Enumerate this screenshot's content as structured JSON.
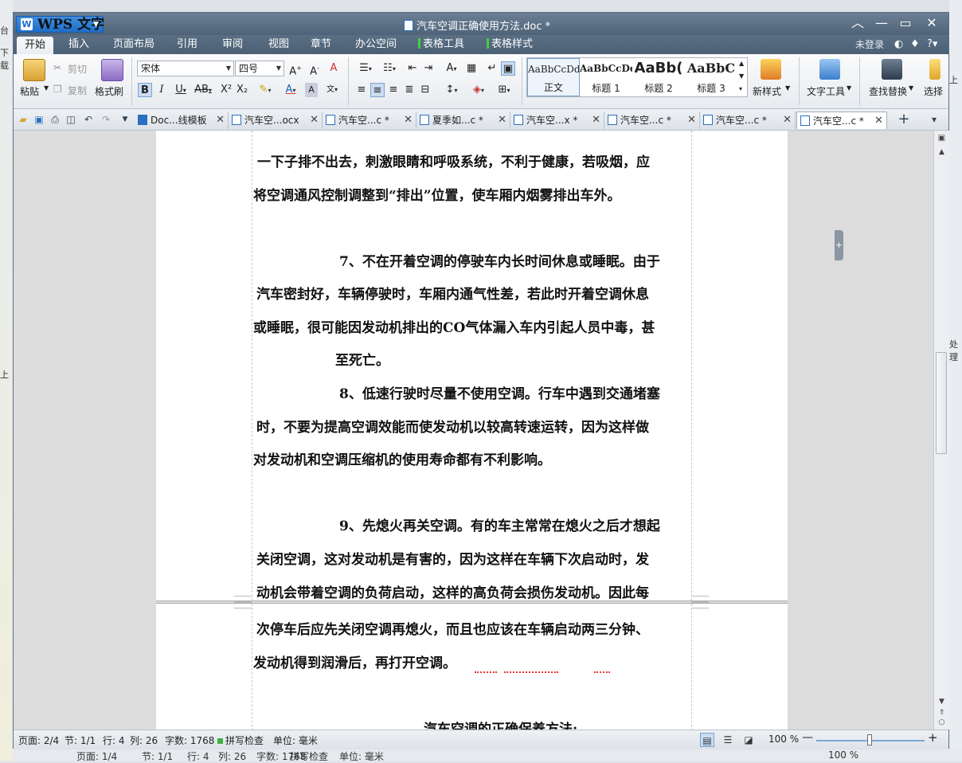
{
  "app": {
    "button_label": "WPS 文字",
    "doc_title": "汽车空调正确使用方法.doc *",
    "account_status": "未登录"
  },
  "menus": [
    "开始",
    "插入",
    "页面布局",
    "引用",
    "审阅",
    "视图",
    "章节",
    "办公空间",
    "表格工具",
    "表格样式"
  ],
  "ribbon": {
    "paste": "粘贴",
    "cut": "剪切",
    "copy": "复制",
    "format_painter": "格式刷",
    "font_name": "宋体",
    "font_size": "四号",
    "style_samples": [
      "AaBbCcDd",
      "AaBbCcDd",
      "AaBb(",
      "AaBbC"
    ],
    "style_labels": [
      "正文",
      "标题 1",
      "标题 2",
      "标题 3"
    ],
    "new_style": "新样式",
    "text_tools": "文字工具",
    "find_replace": "查找替换",
    "select": "选择"
  },
  "tabs": [
    {
      "label": "Doc...线模板"
    },
    {
      "label": "汽车空...ocx"
    },
    {
      "label": "汽车空...c *"
    },
    {
      "label": "夏季如...c *"
    },
    {
      "label": "汽车空...x *"
    },
    {
      "label": "汽车空...c *"
    },
    {
      "label": "汽车空...c *"
    },
    {
      "label": "汽车空...c *"
    }
  ],
  "document": {
    "lines": [
      "一下子排不出去，刺激眼睛和呼吸系统，不利于健康，若吸烟，应",
      "将空调通风控制调整到“排出”位置，使车厢内烟雾排出车外。",
      "7、不在开着空调的停驶车内长时间休息或睡眠。由于",
      "汽车密封好，车辆停驶时，车厢内通气性差，若此时开着空调休息",
      "或睡眠，很可能因发动机排出的CO气体漏入车内引起人员中毒，甚",
      "至死亡。",
      "8、低速行驶时尽量不使用空调。行车中遇到交通堵塞",
      "时，不要为提高空调效能而使发动机以较高转速运转，因为这样做",
      "对发动机和空调压缩机的使用寿命都有不利影响。",
      "9、先熄火再关空调。有的车主常常在熄火之后才想起",
      "关闭空调，这对发动机是有害的，因为这样在车辆下次启动时，发",
      "动机会带着空调的负荷启动，这样的高负荷会损伤发动机。因此每"
    ],
    "page2_lines": [
      "次停车后应先关闭空调再熄火，而且也应该在车辆启动两三分钟、",
      "发动机得到润滑后，再打开空调。",
      "汽车空调的正确保养方法:"
    ]
  },
  "status": {
    "page": "页面: 2/4",
    "section": "节: 1/1",
    "row": "行: 4",
    "col": "列: 26",
    "word_count": "字数: 1768",
    "spell_check": "拼写检查",
    "unit": "单位: 毫米",
    "zoom": "100 %"
  },
  "background_window": {
    "status_text": [
      "页面: 1/4",
      "节: 1/1",
      "行: 4",
      "列: 26",
      "字数: 1768",
      "拼写检查",
      "单位: 毫米",
      "100 %"
    ],
    "left_fragments": [
      "台",
      "下载",
      "上"
    ],
    "right_fragments": [
      "上",
      "处理"
    ]
  },
  "colors": {
    "title_bar": "#5a6f84",
    "accent_blue": "#1f6ec8",
    "spell_error": "#e33333"
  }
}
